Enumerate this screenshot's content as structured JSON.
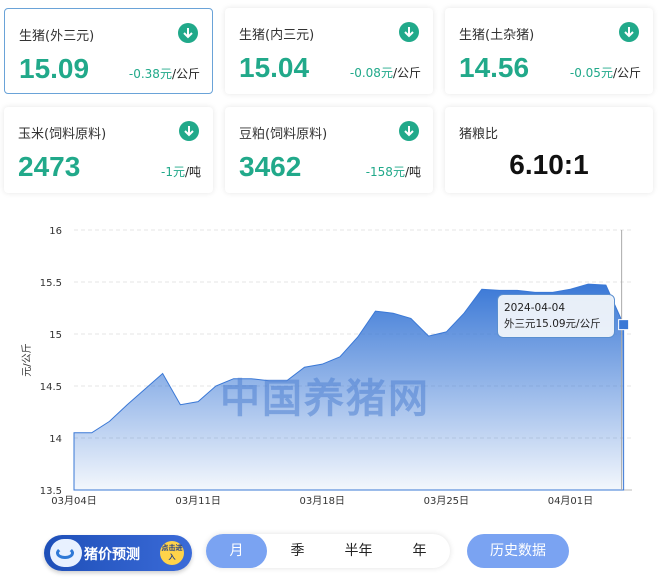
{
  "cards": [
    {
      "title": "生猪(外三元)",
      "price": "15.09",
      "change": "-0.38元",
      "unit": "/公斤"
    },
    {
      "title": "生猪(内三元)",
      "price": "15.04",
      "change": "-0.08元",
      "unit": "/公斤"
    },
    {
      "title": "生猪(土杂猪)",
      "price": "14.56",
      "change": "-0.05元",
      "unit": "/公斤"
    },
    {
      "title": "玉米(饲料原料)",
      "price": "2473",
      "change": "-1元",
      "unit": "/吨"
    },
    {
      "title": "豆粕(饲料原料)",
      "price": "3462",
      "change": "-158元",
      "unit": "/吨"
    }
  ],
  "ratio": {
    "title": "猪粮比",
    "value": "6.10:1"
  },
  "colors": {
    "accent_green": "#21a98a",
    "chart_blue": "#3a78d6",
    "button_blue": "#7aa3f2"
  },
  "watermark": "中国养猪网",
  "tooltip": {
    "date": "2024-04-04",
    "text": "外三元15.09元/公斤"
  },
  "chart_data": {
    "type": "area",
    "ylabel": "元/公斤",
    "ylim": [
      13.5,
      16
    ],
    "yticks": [
      "16",
      "15.5",
      "15",
      "14.5",
      "14",
      "13.5"
    ],
    "xtick_labels": [
      "03月04日",
      "03月11日",
      "03月18日",
      "03月25日",
      "04月01日"
    ],
    "grid": true,
    "series": [
      {
        "x": [
          "03-04",
          "03-05",
          "03-06",
          "03-07",
          "03-08",
          "03-09",
          "03-10",
          "03-11",
          "03-12",
          "03-13",
          "03-14",
          "03-15",
          "03-16",
          "03-17",
          "03-18",
          "03-19",
          "03-20",
          "03-21",
          "03-22",
          "03-23",
          "03-24",
          "03-25",
          "03-26",
          "03-27",
          "03-28",
          "03-29",
          "03-30",
          "03-31",
          "04-01",
          "04-02",
          "04-03",
          "04-04"
        ],
        "values": [
          14.05,
          14.05,
          14.16,
          14.32,
          14.47,
          14.62,
          14.32,
          14.35,
          14.5,
          14.57,
          14.57,
          14.55,
          14.55,
          14.68,
          14.71,
          14.78,
          14.97,
          15.22,
          15.2,
          15.15,
          14.98,
          15.02,
          15.2,
          15.43,
          15.42,
          15.42,
          15.4,
          15.4,
          15.43,
          15.48,
          15.47,
          15.09
        ]
      }
    ]
  },
  "forecast": {
    "label": "猪价预测",
    "badge": "点击进入"
  },
  "periods": [
    "月",
    "季",
    "半年",
    "年"
  ],
  "history_button": "历史数据"
}
